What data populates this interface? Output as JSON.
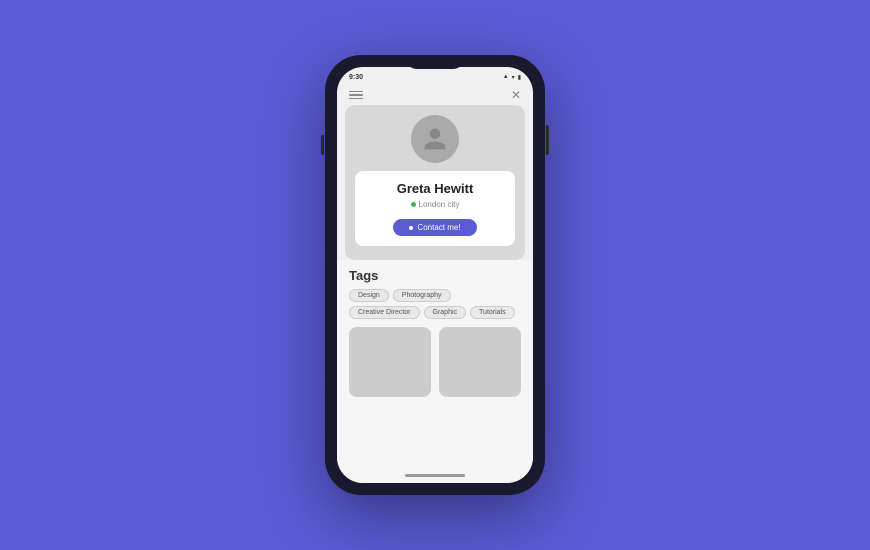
{
  "background_color": "#5b5bd6",
  "phone": {
    "status_bar": {
      "time": "9:30",
      "icons": [
        "signal",
        "wifi",
        "battery"
      ]
    },
    "top_bar": {
      "menu_label": "menu",
      "close_label": "close"
    },
    "profile": {
      "name": "Greta Hewitt",
      "location": "London city",
      "location_dot_color": "#4caf50",
      "contact_button_label": "Contact me!"
    },
    "tags_section": {
      "heading": "Tags",
      "tags": [
        {
          "label": "Design"
        },
        {
          "label": "Photography"
        },
        {
          "label": "Creative Director"
        },
        {
          "label": "Graphic"
        },
        {
          "label": "Tutorials"
        }
      ]
    },
    "home_indicator": true
  }
}
